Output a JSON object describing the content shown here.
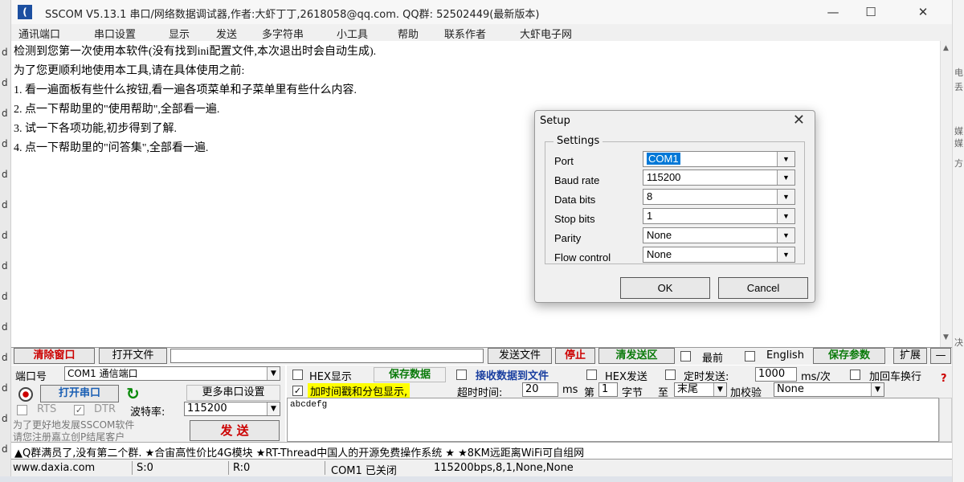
{
  "window": {
    "title": "SSCOM V5.13.1 串口/网络数据调试器,作者:大虾丁丁,2618058@qq.com. QQ群: 52502449(最新版本)",
    "logo": "(",
    "min_glyph": "—",
    "max_glyph": "☐",
    "close_glyph": "✕"
  },
  "menu": [
    "通讯端口",
    "串口设置",
    "显示",
    "发送",
    "多字符串",
    "小工具",
    "帮助",
    "联系作者",
    "大虾电子网"
  ],
  "receive_lines": [
    "检测到您第一次使用本软件(没有找到ini配置文件,本次退出时会自动生成).",
    "为了您更顺利地使用本工具,请在具体使用之前:",
    "1. 看一遍面板有些什么按钮,看一遍各项菜单和子菜单里有些什么内容.",
    "2. 点一下帮助里的\"使用帮助\",全部看一遍.",
    "3. 试一下各项功能,初步得到了解.",
    "4. 点一下帮助里的\"问答集\",全部看一遍."
  ],
  "toolbar": {
    "clear": "清除窗口",
    "open_file": "打开文件",
    "send_file": "发送文件",
    "stop": "停止",
    "clear_send": "清发送区",
    "topmost": "最前",
    "english": "English",
    "save_params": "保存参数",
    "expand": "扩展",
    "collapse": "—"
  },
  "port": {
    "label": "端口号",
    "value": "COM1 通信端口",
    "open_btn": "打开串口",
    "more_settings": "更多串口设置",
    "rts": "RTS",
    "dtr": "DTR",
    "baud_label": "波特率:",
    "baud_value": "115200",
    "promo1": "为了更好地发展SSCOM软件",
    "promo2": "请您注册嘉立创P结尾客户",
    "send_btn": "发 送",
    "check": "✓",
    "refresh_icon": "↻"
  },
  "options": {
    "hex_display": "HEX显示",
    "save_data": "保存数据",
    "recv_to_file": "接收数据到文件",
    "hex_send": "HEX发送",
    "timed_send": "定时发送:",
    "timed_value": "1000",
    "timed_unit": "ms/次",
    "add_crlf": "加回车换行",
    "timestamp": "加时间戳和分包显示,",
    "timeout_label": "超时时间:",
    "timeout_value": "20",
    "timeout_unit": "ms",
    "byte_label": "第",
    "byte_value": "1",
    "byte_unit": "字节",
    "to_label": "至",
    "to_value": "末尾",
    "checksum_label": "加校验",
    "checksum_value": "None",
    "help_glyph": "?"
  },
  "send_text": "abcdefg",
  "ad_text": "▲Q群满员了,没有第二个群. ★合宙高性价比4G模块 ★RT-Thread中国人的开源免费操作系统 ★ ★8KM远距离WiFi可自组网",
  "status": {
    "url": "www.daxia.com",
    "sent": "S:0",
    "recv": "R:0",
    "port_state": "COM1 已关闭",
    "params": "115200bps,8,1,None,None"
  },
  "dialog": {
    "title": "Setup",
    "group": "Settings",
    "fields": [
      {
        "label": "Port",
        "value": "COM1"
      },
      {
        "label": "Baud rate",
        "value": "115200"
      },
      {
        "label": "Data bits",
        "value": "8"
      },
      {
        "label": "Stop bits",
        "value": "1"
      },
      {
        "label": "Parity",
        "value": "None"
      },
      {
        "label": "Flow control",
        "value": "None"
      }
    ],
    "ok": "OK",
    "cancel": "Cancel"
  },
  "edge": {
    "left_chars": [
      "d",
      "d",
      "d",
      "d",
      "d",
      "d",
      "d",
      "d",
      "d",
      "d",
      "d",
      "d",
      "d",
      "d"
    ],
    "right_chars": [
      "电",
      "丢",
      "媒",
      "媒",
      "方",
      "决"
    ]
  },
  "colors": {
    "accent_red": "#c00000",
    "accent_green": "#0a7a0a",
    "highlight_yellow": "#ffff00",
    "selection": "#0078d7"
  }
}
